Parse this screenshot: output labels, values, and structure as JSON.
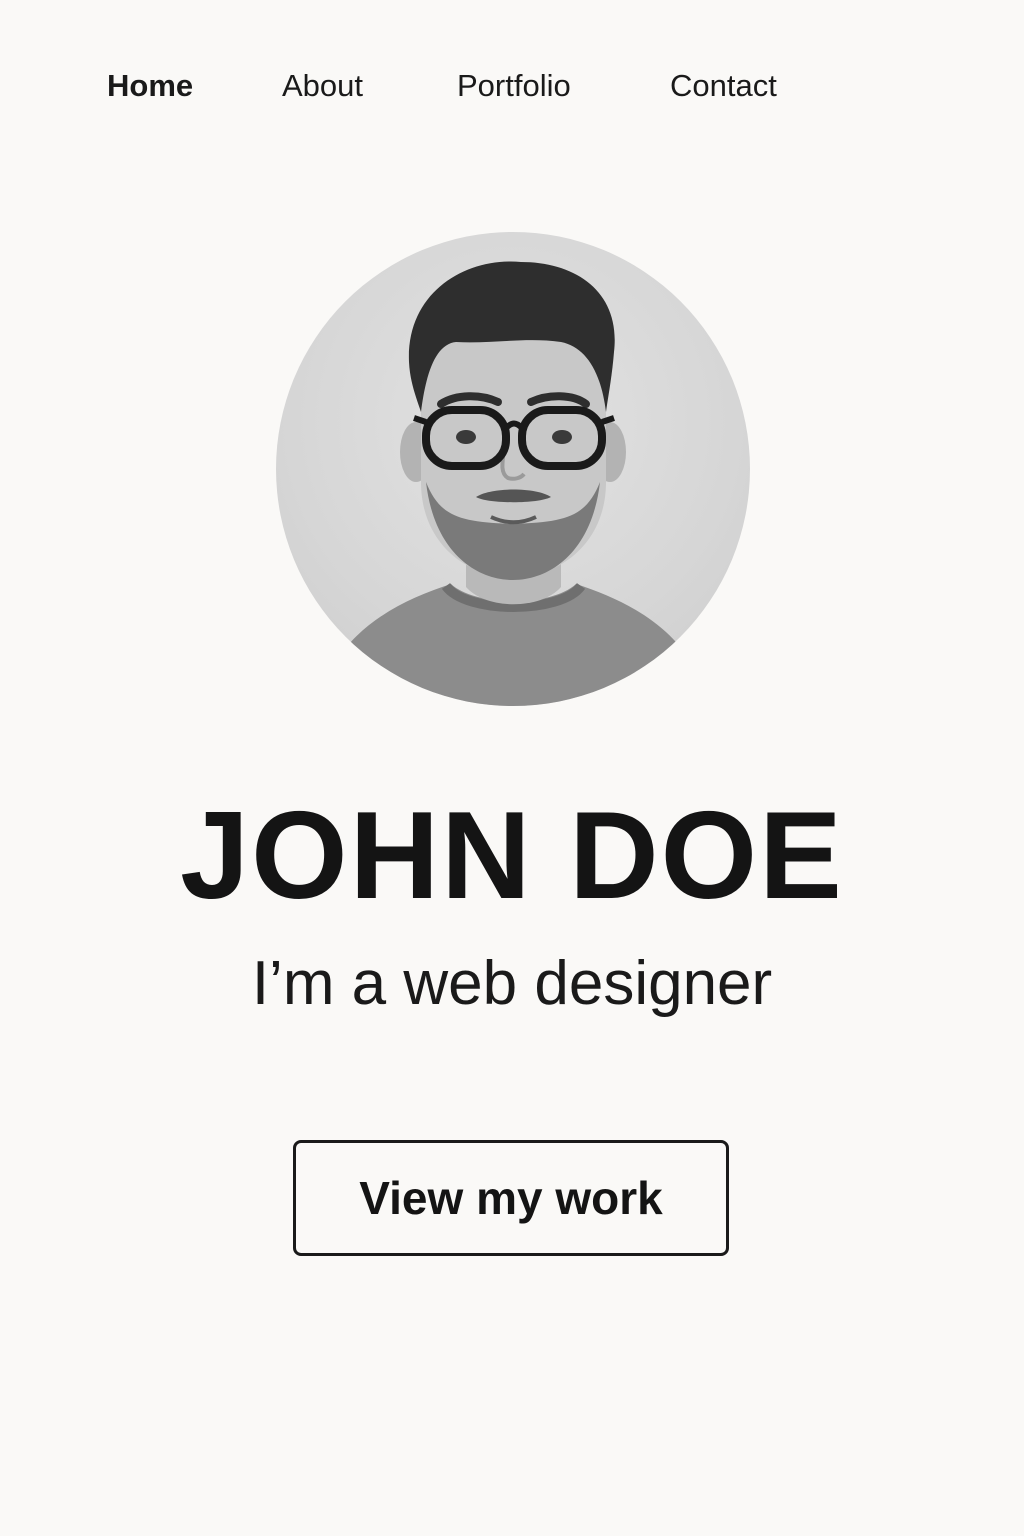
{
  "nav": {
    "items": [
      {
        "label": "Home",
        "active": true
      },
      {
        "label": "About",
        "active": false
      },
      {
        "label": "Portfolio",
        "active": false
      },
      {
        "label": "Contact",
        "active": false
      }
    ]
  },
  "hero": {
    "name": "JOHN DOE",
    "tagline": "I’m a web designer",
    "cta_label": "View my work"
  },
  "colors": {
    "background": "#faf9f7",
    "text": "#141414",
    "avatar_background": "#d6d6d6"
  },
  "icons": {
    "avatar": "profile-photo"
  }
}
